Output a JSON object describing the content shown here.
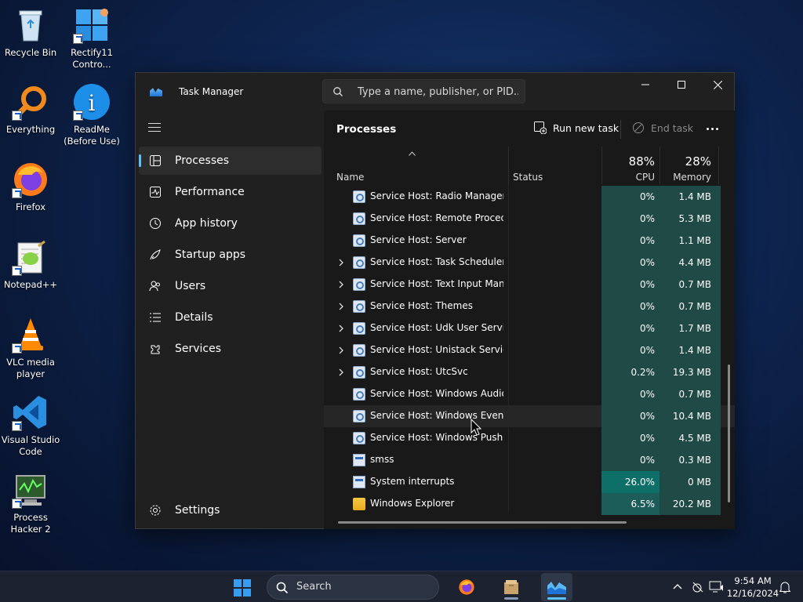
{
  "desktop": {
    "icons": [
      {
        "label": "Recycle Bin"
      },
      {
        "label": "Rectify11 Contro..."
      },
      {
        "label": "Everything"
      },
      {
        "label": "ReadMe (Before Use)"
      },
      {
        "label": "Firefox"
      },
      {
        "label": "Notepad++"
      },
      {
        "label": "VLC media player"
      },
      {
        "label": "Visual Studio Code"
      },
      {
        "label": "Process Hacker 2"
      }
    ]
  },
  "window": {
    "title": "Task Manager",
    "search_placeholder": "Type a name, publisher, or PID..."
  },
  "nav": {
    "items": [
      {
        "label": "Processes",
        "icon": "processes-icon"
      },
      {
        "label": "Performance",
        "icon": "performance-icon"
      },
      {
        "label": "App history",
        "icon": "history-icon"
      },
      {
        "label": "Startup apps",
        "icon": "startup-icon"
      },
      {
        "label": "Users",
        "icon": "users-icon"
      },
      {
        "label": "Details",
        "icon": "details-icon"
      },
      {
        "label": "Services",
        "icon": "services-icon"
      }
    ],
    "settings_label": "Settings"
  },
  "content": {
    "title": "Processes",
    "run_new_task": "Run new task",
    "end_task": "End task",
    "columns": {
      "name": "Name",
      "status": "Status",
      "cpu_total": "88%",
      "cpu": "CPU",
      "memory_total": "28%",
      "memory": "Memory"
    },
    "rows": [
      {
        "name": "Service Host: Radio Managem...",
        "cpu": "0%",
        "mem": "1.4 MB",
        "expand": false,
        "icon": "gear"
      },
      {
        "name": "Service Host: Remote Procedu...",
        "cpu": "0%",
        "mem": "5.3 MB",
        "expand": false,
        "icon": "gear"
      },
      {
        "name": "Service Host: Server",
        "cpu": "0%",
        "mem": "1.1 MB",
        "expand": false,
        "icon": "gear"
      },
      {
        "name": "Service Host: Task Scheduler",
        "cpu": "0%",
        "mem": "4.4 MB",
        "expand": true,
        "icon": "gear"
      },
      {
        "name": "Service Host: Text Input Mana...",
        "cpu": "0%",
        "mem": "0.7 MB",
        "expand": true,
        "icon": "gear"
      },
      {
        "name": "Service Host: Themes",
        "cpu": "0%",
        "mem": "0.7 MB",
        "expand": true,
        "icon": "gear"
      },
      {
        "name": "Service Host: Udk User Service...",
        "cpu": "0%",
        "mem": "1.7 MB",
        "expand": true,
        "icon": "gear"
      },
      {
        "name": "Service Host: Unistack Service ...",
        "cpu": "0%",
        "mem": "1.4 MB",
        "expand": true,
        "icon": "gear"
      },
      {
        "name": "Service Host: UtcSvc",
        "cpu": "0.2%",
        "mem": "19.3 MB",
        "expand": true,
        "icon": "gear"
      },
      {
        "name": "Service Host: Windows Audio ...",
        "cpu": "0%",
        "mem": "0.7 MB",
        "expand": false,
        "icon": "gear"
      },
      {
        "name": "Service Host: Windows Event ...",
        "cpu": "0%",
        "mem": "10.4 MB",
        "expand": false,
        "icon": "gear"
      },
      {
        "name": "Service Host: Windows Push ...",
        "cpu": "0%",
        "mem": "4.5 MB",
        "expand": false,
        "icon": "gear"
      },
      {
        "name": "smss",
        "cpu": "0%",
        "mem": "0.3 MB",
        "expand": false,
        "icon": "window"
      },
      {
        "name": "System interrupts",
        "cpu": "26.0%",
        "mem": "0 MB",
        "expand": false,
        "icon": "window"
      },
      {
        "name": "Windows Explorer",
        "cpu": "6.5%",
        "mem": "20.2 MB",
        "expand": false,
        "icon": "folder"
      }
    ]
  },
  "taskbar": {
    "search_label": "Search",
    "time": "9:54 AM",
    "date": "12/16/2024"
  },
  "colors": {
    "heat_low": "#1f4a46",
    "heat_mid": "#1c5d59",
    "heat_high": "#0e6e68",
    "accent": "#5cc2ff"
  }
}
